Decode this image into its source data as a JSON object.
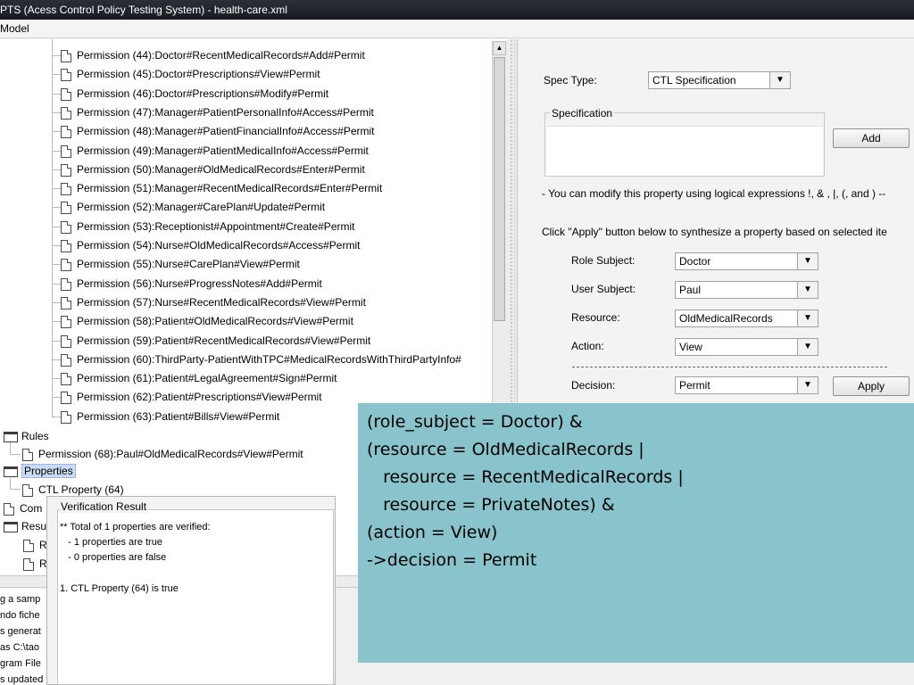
{
  "window": {
    "title": "PTS (Acess Control Policy Testing System) - health-care.xml"
  },
  "menu": {
    "items": [
      "Model"
    ]
  },
  "tree": {
    "permissions": [
      "Permission (44):Doctor#RecentMedicalRecords#Add#Permit",
      "Permission (45):Doctor#Prescriptions#View#Permit",
      "Permission (46):Doctor#Prescriptions#Modify#Permit",
      "Permission (47):Manager#PatientPersonalInfo#Access#Permit",
      "Permission (48):Manager#PatientFinancialInfo#Access#Permit",
      "Permission (49):Manager#PatientMedicalInfo#Access#Permit",
      "Permission (50):Manager#OldMedicalRecords#Enter#Permit",
      "Permission (51):Manager#RecentMedicalRecords#Enter#Permit",
      "Permission (52):Manager#CarePlan#Update#Permit",
      "Permission (53):Receptionist#Appointment#Create#Permit",
      "Permission (54):Nurse#OldMedicalRecords#Access#Permit",
      "Permission (55):Nurse#CarePlan#View#Permit",
      "Permission (56):Nurse#ProgressNotes#Add#Permit",
      "Permission (57):Nurse#RecentMedicalRecords#View#Permit",
      "Permission (58):Patient#OldMedicalRecords#View#Permit",
      "Permission (59):Patient#RecentMedicalRecords#View#Permit",
      "Permission (60):ThirdParty-PatientWithTPC#MedicalRecordsWithThirdPartyInfo#",
      "Permission (61):Patient#LegalAgreement#Sign#Permit",
      "Permission (62):Patient#Prescriptions#View#Permit",
      "Permission (63):Patient#Bills#View#Permit"
    ],
    "rules_label": "Rules",
    "rule_item": "Permission (68):Paul#OldMedicalRecords#View#Permit",
    "properties_label": "Properties",
    "property_item": "CTL Property (64)",
    "com_label": "Com",
    "resu_label": "Resu",
    "r1": "R",
    "r2": "R"
  },
  "spec": {
    "spec_type_label": "Spec Type:",
    "spec_type_value": "CTL Specification",
    "specification_legend": "Specification",
    "add_button": "Add",
    "hint": "- You can modify this property using logical expressions !, & , |, (, and ) --",
    "apply_hint": "Click \"Apply\" button below to synthesize a property based on selected ite",
    "role_subject_label": "Role Subject:",
    "role_subject_value": "Doctor",
    "user_subject_label": "User Subject:",
    "user_subject_value": "Paul",
    "resource_label": "Resource:",
    "resource_value": "OldMedicalRecords",
    "action_label": "Action:",
    "action_value": "View",
    "decision_label": "Decision:",
    "decision_value": "Permit",
    "apply_button": "Apply"
  },
  "overlay": {
    "lines": [
      "(role_subject = Doctor) &",
      "(resource = OldMedicalRecords |",
      "   resource = RecentMedicalRecords |",
      "   resource = PrivateNotes) &",
      "(action = View)",
      "->decision = Permit"
    ]
  },
  "verification": {
    "title": "Verification Result",
    "lines": [
      "** Total of 1 properties are verified:",
      "   - 1 properties are true",
      "   - 0 properties are false",
      "",
      "1. CTL Property (64) is true"
    ]
  },
  "console": {
    "lines": [
      "g a samp",
      "ndo fiche",
      "s generat",
      "as C:\\tao",
      "gram File",
      "s updated"
    ]
  }
}
